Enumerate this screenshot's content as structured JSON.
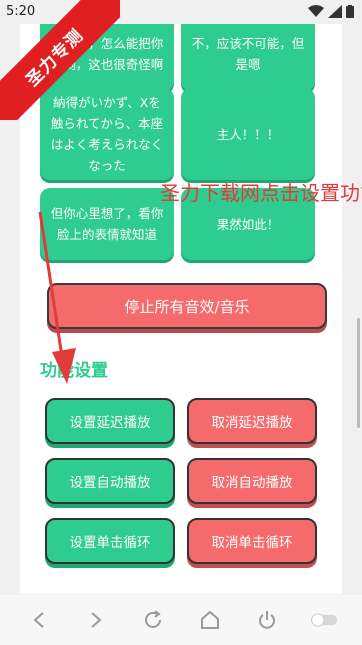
{
  "status_bar": {
    "time": "5:20"
  },
  "banner": {
    "label": "圣力专测"
  },
  "tiles": [
    {
      "text": "哪一样，怎么能把你推倒，这也很奇怪啊"
    },
    {
      "text": "不，应该不可能，但是嗯"
    },
    {
      "text": "納得がいかず、Xを触られてから、本座はよく考えられなくなった"
    },
    {
      "text": "主人！！！"
    },
    {
      "text": "但你心里想了，看你脸上的表情就知道"
    },
    {
      "text": "果然如此！"
    }
  ],
  "stop_button": {
    "label": "停止所有音效/音乐"
  },
  "section": {
    "title": "功能设置"
  },
  "functions": {
    "set_delay": "设置延迟播放",
    "cancel_delay": "取消延迟播放",
    "set_auto": "设置自动播放",
    "cancel_auto": "取消自动播放",
    "set_loop": "设置单击循环",
    "cancel_loop": "取消单击循环"
  },
  "overlay": {
    "text": "圣力下载网点击设置功能"
  },
  "colors": {
    "green": "#2ecc8e",
    "red": "#f56b6b",
    "banner": "#e02020",
    "overlay_text": "#e23b3b"
  },
  "bottom_nav": [
    "back-icon",
    "forward-icon",
    "refresh-icon",
    "home-icon",
    "power-icon",
    "toggle-icon"
  ]
}
